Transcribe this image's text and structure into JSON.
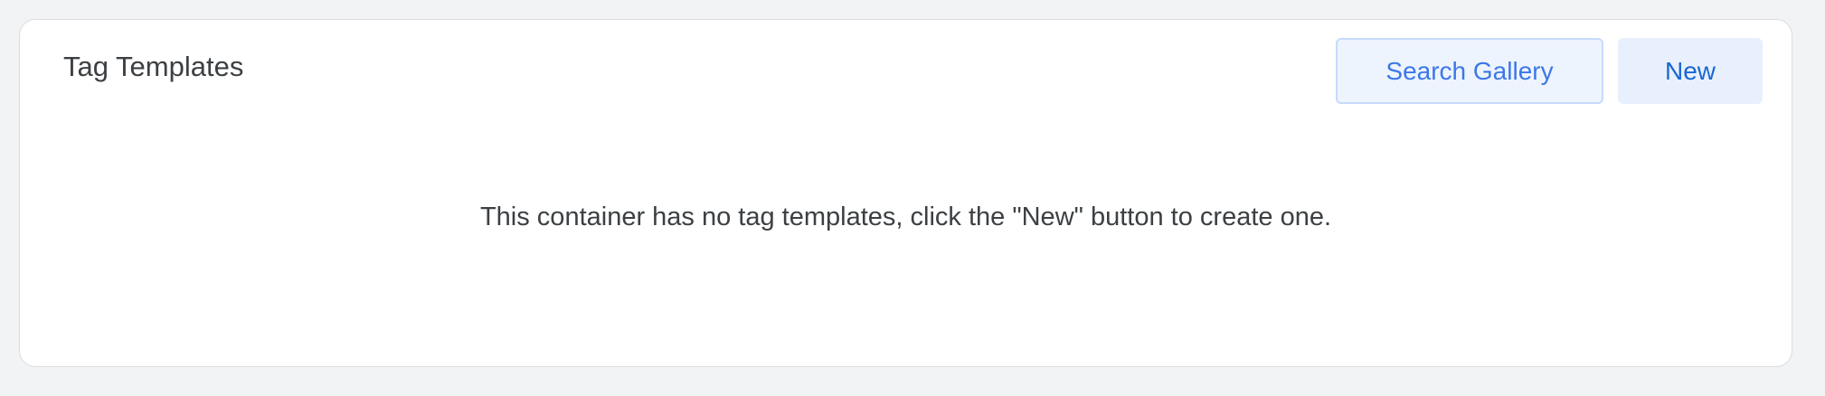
{
  "panel": {
    "title": "Tag Templates",
    "search_gallery_label": "Search Gallery",
    "new_label": "New",
    "empty_message": "This container has no tag templates, click the \"New\" button to create one."
  },
  "colors": {
    "page_background": "#f1f3f4",
    "card_background": "#ffffff",
    "accent": "#1a73e8",
    "text": "#3c4043"
  }
}
